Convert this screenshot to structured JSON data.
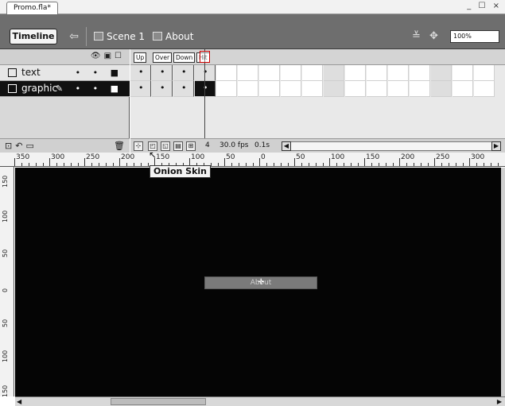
{
  "window": {
    "doc_tab": "Promo.fla*",
    "controls": "_ ☐ ×"
  },
  "header": {
    "timeline_label": "Timeline",
    "breadcrumbs": [
      {
        "label": "Scene 1",
        "icon": "scene-icon"
      },
      {
        "label": "About",
        "icon": "button-symbol-icon"
      }
    ],
    "zoom": "100%"
  },
  "layers": {
    "header_icons": [
      "eye-icon",
      "lock-icon",
      "outline-icon"
    ],
    "items": [
      {
        "name": "text",
        "selected": false
      },
      {
        "name": "graphic",
        "selected": true
      }
    ],
    "footer_icons": [
      "insert-layer-icon",
      "add-motion-guide-icon",
      "insert-folder-icon",
      "trash-icon"
    ]
  },
  "frames": {
    "states": [
      "Up",
      "Over",
      "Down",
      "Hit"
    ],
    "current_frame": "4",
    "fps": "30.0 fps",
    "elapsed": "0.1s"
  },
  "ruler": {
    "top_labels": [
      "350",
      "300",
      "250",
      "200",
      "150",
      "100",
      "50",
      "0",
      "50",
      "100",
      "150",
      "200",
      "250",
      "300"
    ],
    "left_labels": [
      "150",
      "100",
      "50",
      "0",
      "50",
      "100",
      "150"
    ]
  },
  "stage": {
    "button_text": "About",
    "background": "#050505"
  },
  "tooltip": {
    "text": "Onion Skin"
  }
}
